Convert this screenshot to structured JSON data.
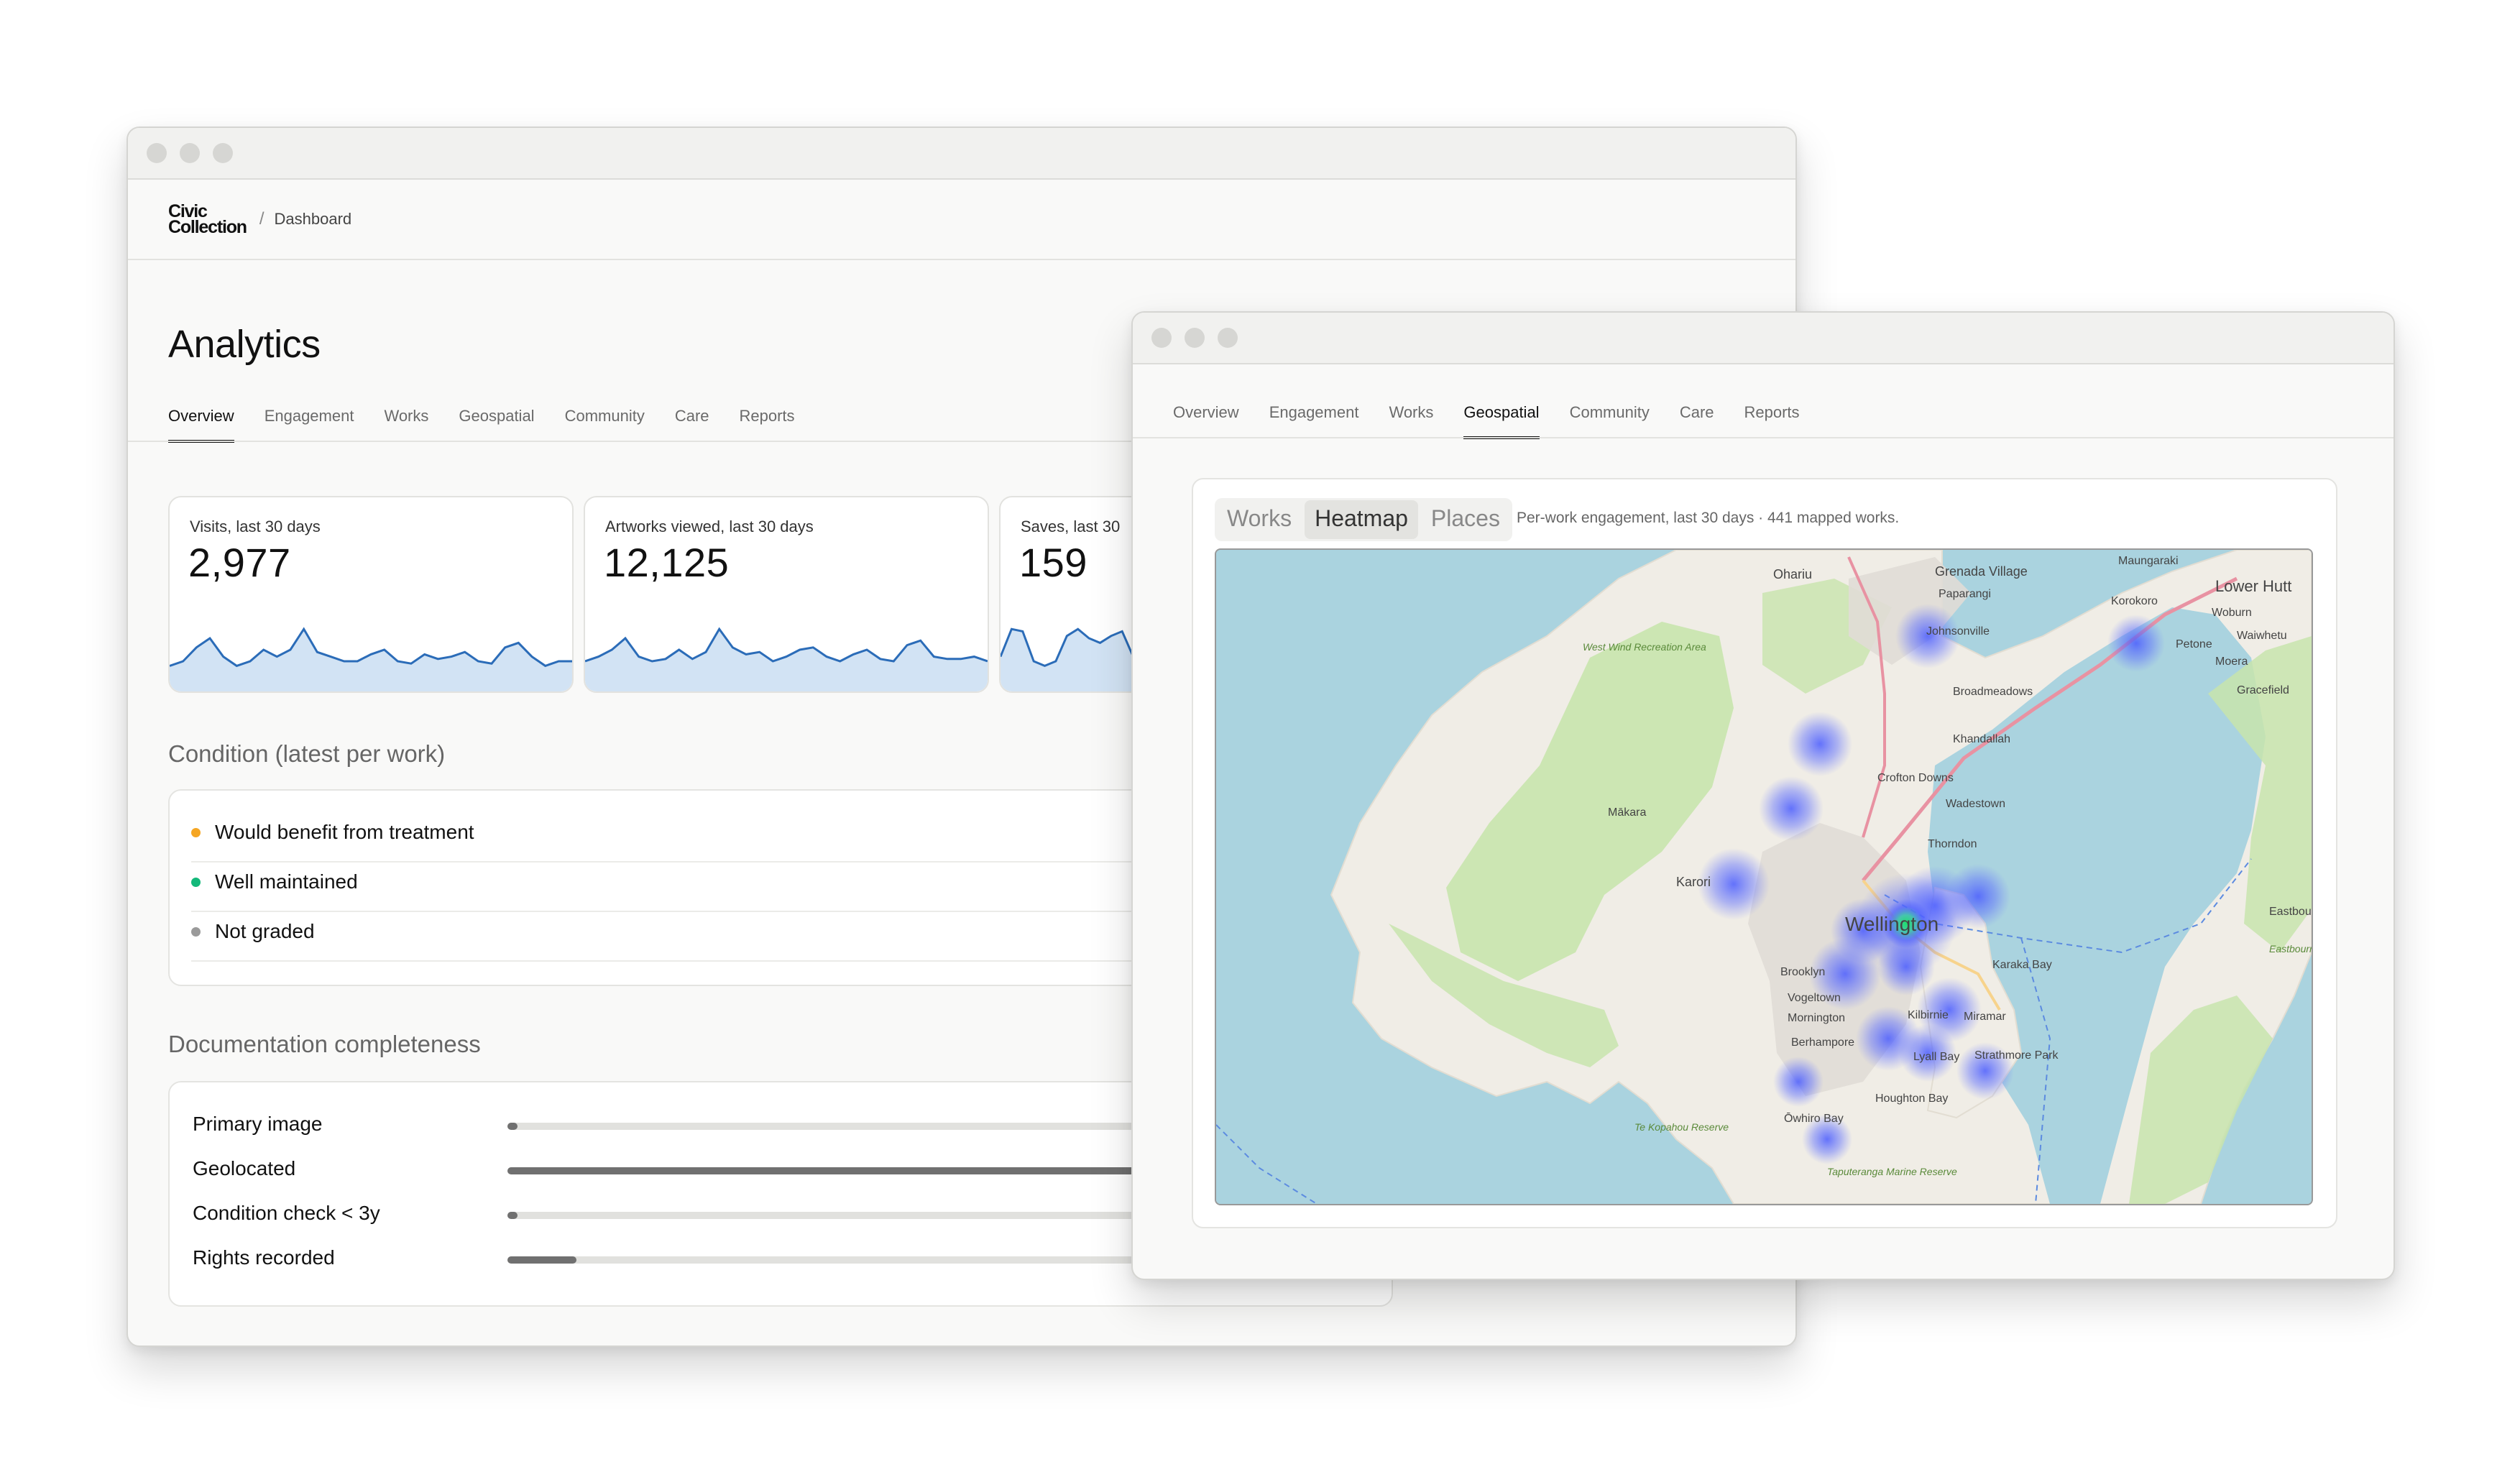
{
  "back_window": {
    "logo_line1": "Civic",
    "logo_line2": "Collection",
    "breadcrumb_sep": "/",
    "breadcrumb": "Dashboard",
    "title": "Analytics",
    "tabs": [
      "Overview",
      "Engagement",
      "Works",
      "Geospatial",
      "Community",
      "Care",
      "Reports"
    ],
    "active_tab": "Overview",
    "kpis": [
      {
        "label": "Visits, last 30 days",
        "value": "2,977",
        "trend": [
          18,
          20,
          26,
          30,
          22,
          18,
          20,
          25,
          22,
          25,
          34,
          24,
          22,
          20,
          20,
          23,
          25,
          20,
          19,
          23,
          21,
          22,
          24,
          20,
          19,
          26,
          28,
          22,
          18,
          20,
          20
        ]
      },
      {
        "label": "Artworks viewed, last 30 days",
        "value": "12,125",
        "trend": [
          20,
          22,
          25,
          30,
          22,
          20,
          21,
          25,
          21,
          24,
          34,
          26,
          23,
          24,
          20,
          22,
          25,
          26,
          22,
          20,
          23,
          25,
          21,
          20,
          27,
          29,
          22,
          21,
          21,
          22,
          20
        ]
      },
      {
        "label": "Saves, last 30",
        "value": "159",
        "trend": [
          22,
          34,
          33,
          20,
          18,
          20,
          31,
          34,
          30,
          28,
          31,
          33,
          22,
          20
        ]
      }
    ],
    "condition_title": "Condition (latest per work)",
    "condition_items": [
      {
        "label": "Would benefit from treatment",
        "color": "#f5a623"
      },
      {
        "label": "Well maintained",
        "color": "#14b87a"
      },
      {
        "label": "Not graded",
        "color": "#9a9a9a"
      }
    ],
    "documentation_title": "Documentation completeness",
    "documentation_items": [
      {
        "label": "Primary image",
        "value": 0.0
      },
      {
        "label": "Geolocated",
        "value": 0.78
      },
      {
        "label": "Condition check < 3y",
        "value": 0.0
      },
      {
        "label": "Rights recorded",
        "value": 0.08
      }
    ]
  },
  "front_window": {
    "tabs": [
      "Overview",
      "Engagement",
      "Works",
      "Geospatial",
      "Community",
      "Care",
      "Reports"
    ],
    "active_tab": "Geospatial",
    "segments": [
      "Works",
      "Heatmap",
      "Places"
    ],
    "active_segment": "Heatmap",
    "note": "Per-work engagement, last 30 days · 441 mapped works.",
    "map_labels": [
      "Ohariu",
      "Grenada Village",
      "Paparangi",
      "Maungaraki",
      "Korokoro",
      "Lower Hutt",
      "Woburn",
      "Waiwhetu",
      "Petone",
      "Moera",
      "Gracefield",
      "Johnsonville",
      "Broadmeadows",
      "Khandallah",
      "Crofton Downs",
      "Wadestown",
      "Mākara",
      "Thorndon",
      "Wellington",
      "Karori",
      "Brooklyn",
      "Vogeltown",
      "Kilbirnie",
      "Miramar",
      "Karaka Bay",
      "Mornington",
      "Berhampore",
      "Lyall Bay",
      "Strathmore Park",
      "Houghton Bay",
      "Ōwhiro Bay",
      "Eastbourne",
      "West Wind Recreation Area",
      "Te Kopahou Reserve",
      "Taputeranga Marine Reserve",
      "Eastbourne Domain"
    ],
    "colors": {
      "water": "#aad3df",
      "land": "#f2efe9",
      "park": "#cfe6b4",
      "heat": "#4a5cff",
      "heat_peak": "#21e06a"
    }
  }
}
